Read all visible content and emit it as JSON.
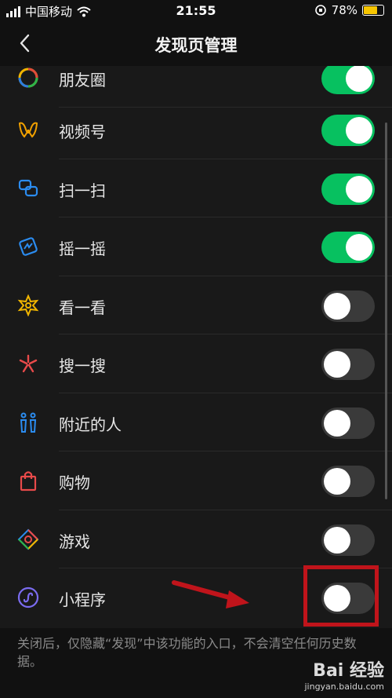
{
  "status_bar": {
    "carrier": "中国移动",
    "time": "21:55",
    "battery_percent": "78%",
    "battery_level": 0.78,
    "battery_color": "#f7c600"
  },
  "nav": {
    "title": "发现页管理",
    "back_icon": "chevron-left-icon"
  },
  "items": [
    {
      "label": "朋友圈",
      "icon": "moments-icon",
      "enabled": true
    },
    {
      "label": "视频号",
      "icon": "channels-icon",
      "enabled": true
    },
    {
      "label": "扫一扫",
      "icon": "scan-icon",
      "enabled": true
    },
    {
      "label": "摇一摇",
      "icon": "shake-icon",
      "enabled": true
    },
    {
      "label": "看一看",
      "icon": "top-stories-icon",
      "enabled": false
    },
    {
      "label": "搜一搜",
      "icon": "search-icon",
      "enabled": false
    },
    {
      "label": "附近的人",
      "icon": "people-nearby-icon",
      "enabled": false
    },
    {
      "label": "购物",
      "icon": "shopping-bag-icon",
      "enabled": false
    },
    {
      "label": "游戏",
      "icon": "games-icon",
      "enabled": false
    },
    {
      "label": "小程序",
      "icon": "mini-programs-icon",
      "enabled": false
    }
  ],
  "footer_note": "关闭后，仅隐藏“发现”中该功能的入口，不会清空任何历史数据。",
  "watermark": {
    "brand": "Bai 经验",
    "url": "jingyan.baidu.com"
  },
  "colors": {
    "toggle_on": "#07c160",
    "toggle_off": "#3a3a3a",
    "annotation": "#c0141b"
  }
}
